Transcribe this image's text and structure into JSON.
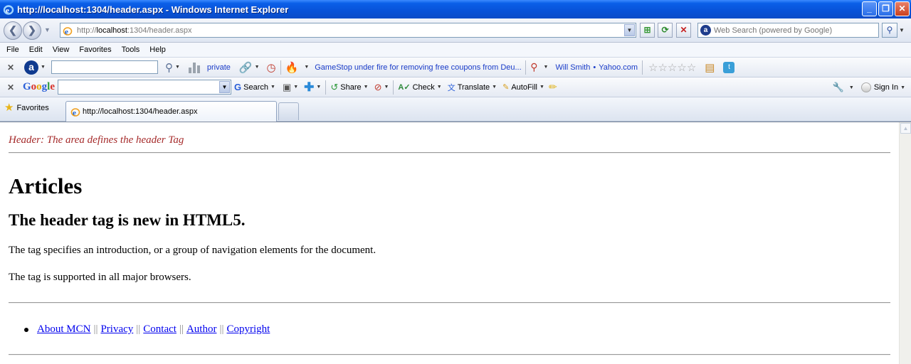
{
  "window": {
    "title": "http://localhost:1304/header.aspx - Windows Internet Explorer",
    "minimize_glyph": "_",
    "maximize_glyph": "❐",
    "close_glyph": "✕"
  },
  "address_bar": {
    "url_prefix": "http://",
    "url_host": "localhost",
    "url_rest": ":1304/header.aspx",
    "search_placeholder": "Web Search (powered by Google)"
  },
  "menu": [
    "File",
    "Edit",
    "View",
    "Favorites",
    "Tools",
    "Help"
  ],
  "ask_toolbar": {
    "private_label": "private",
    "news_ticker": "GameStop under fire for removing free coupons from Deu...",
    "celebrity_link": "Will Smith",
    "source_link": "Yahoo.com",
    "rating_stars": "☆☆☆☆☆"
  },
  "google_toolbar": {
    "logo_text": "Google",
    "search_label": "Search",
    "share_label": "Share",
    "check_label": "Check",
    "translate_label": "Translate",
    "autofill_label": "AutoFill",
    "signin_label": "Sign In"
  },
  "tabs": {
    "favorites_label": "Favorites",
    "active_tab_title": "http://localhost:1304/header.aspx"
  },
  "page": {
    "header_note": "Header: The area defines the header Tag",
    "article_heading": "Articles",
    "subheading": "The header tag is new in HTML5.",
    "paragraph_1": "The tag specifies an introduction, or a group of navigation elements for the document.",
    "paragraph_2": "The tag is supported in all major browsers.",
    "footer_links": [
      "About MCN ",
      "Privacy",
      "Contact",
      "Author",
      "Copyright"
    ],
    "separator": "||"
  },
  "colors": {
    "titlebar_blue": "#0852d8",
    "header_note": "#a52a2a",
    "link": "#0000ee"
  }
}
